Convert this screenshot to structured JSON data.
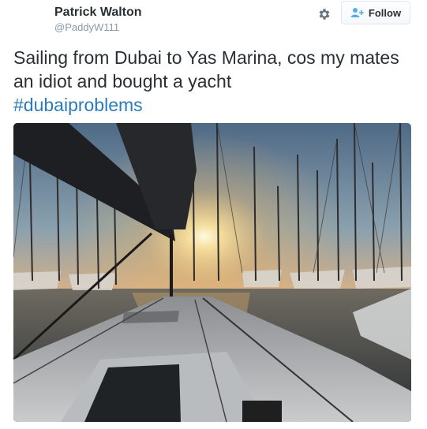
{
  "tweet": {
    "display_name": "Patrick Walton",
    "handle": "@PaddyW111",
    "text": "Sailing from Dubai to Yas Marina, cos my mates an idiot and bought a yacht",
    "hashtag": "#dubaiproblems",
    "follow_label": "Follow",
    "icons": [
      "gear-icon",
      "follow-person-plus-icon"
    ],
    "photo_subject": "sunset over a marina viewed from a yacht deck",
    "colors": {
      "hashtag": "#2b7bb9",
      "text": "#292f33",
      "handle": "#8899a6"
    }
  }
}
